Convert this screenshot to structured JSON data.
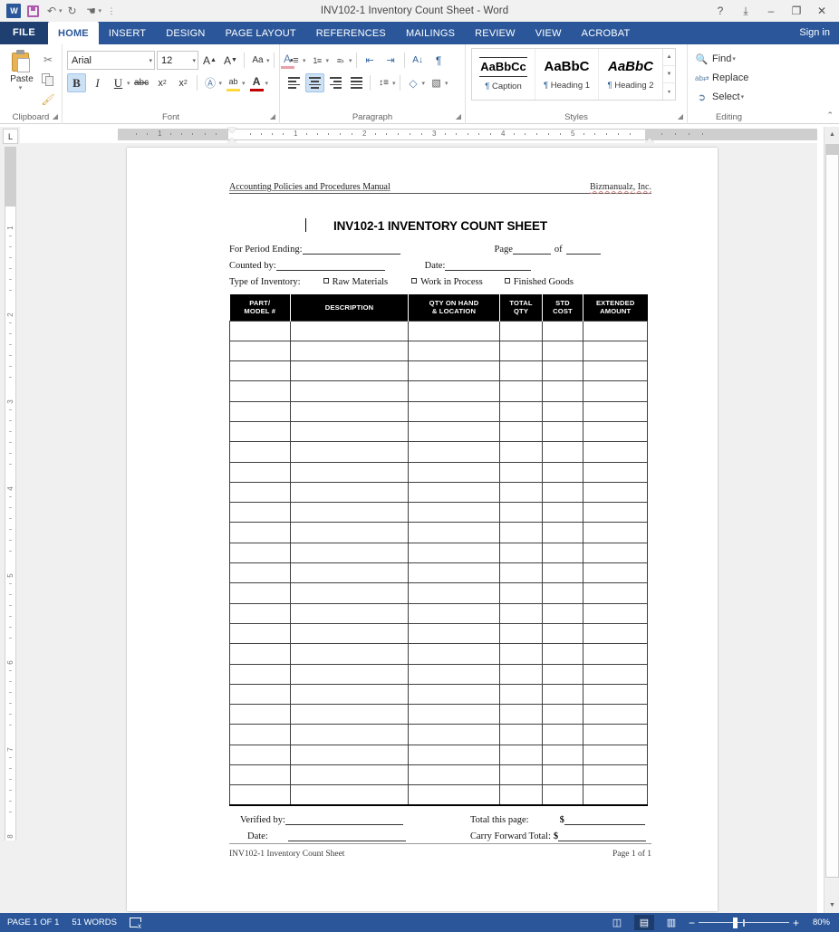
{
  "window": {
    "title": "INV102-1 Inventory Count Sheet - Word",
    "quick_access": [
      {
        "name": "word-logo",
        "glyph": "W"
      },
      {
        "name": "save-icon",
        "glyph": "save"
      },
      {
        "name": "undo-icon",
        "glyph": "↶"
      },
      {
        "name": "redo-icon",
        "glyph": "↻"
      },
      {
        "name": "touch-mouse-mode-icon",
        "glyph": "☚"
      },
      {
        "name": "customize-qat-icon",
        "glyph": "∴"
      }
    ],
    "controls": {
      "help": "?",
      "ribbon_display": "⤓",
      "minimize": "–",
      "maximize": "❐",
      "close": "✕"
    }
  },
  "ribbon": {
    "file_tab": "FILE",
    "tabs": [
      {
        "label": "HOME",
        "active": true
      },
      {
        "label": "INSERT",
        "active": false
      },
      {
        "label": "DESIGN",
        "active": false
      },
      {
        "label": "PAGE LAYOUT",
        "active": false
      },
      {
        "label": "REFERENCES",
        "active": false
      },
      {
        "label": "MAILINGS",
        "active": false
      },
      {
        "label": "REVIEW",
        "active": false
      },
      {
        "label": "VIEW",
        "active": false
      },
      {
        "label": "ACROBAT",
        "active": false
      }
    ],
    "sign_in": "Sign in",
    "groups": {
      "clipboard": {
        "label": "Clipboard",
        "paste": "Paste",
        "cut": "Cut",
        "copy": "Copy",
        "format_painter": "Format Painter"
      },
      "font": {
        "label": "Font",
        "font_name": "Arial",
        "font_size": "12",
        "grow_font": "A",
        "shrink_font": "A",
        "change_case": "Aa",
        "clear_formatting": "A",
        "bold": "B",
        "italic": "I",
        "underline": "U",
        "strikethrough": "abc",
        "subscript": "x",
        "superscript": "x",
        "text_effects": "A",
        "highlight": "ab",
        "font_color": "A"
      },
      "paragraph": {
        "label": "Paragraph",
        "bullets": "•≡",
        "numbering": "≡",
        "multilevel": "≡",
        "decrease_indent": "⇤",
        "increase_indent": "⇥",
        "sort": "A↓",
        "show_marks": "¶",
        "align_left": "left",
        "align_center": "center",
        "align_right": "right",
        "justify": "justify",
        "line_spacing": "↕≡",
        "shading": "shade",
        "borders": "borders"
      },
      "styles": {
        "label": "Styles",
        "items": [
          {
            "preview": "AaBbCc",
            "name": "Caption",
            "mark": "¶"
          },
          {
            "preview": "AaBbC",
            "name": "Heading 1",
            "mark": "¶"
          },
          {
            "preview": "AaBbC",
            "name": "Heading 2",
            "mark": "¶"
          }
        ]
      },
      "editing": {
        "label": "Editing",
        "find": "Find",
        "replace": "Replace",
        "select": "Select"
      }
    },
    "collapse": "⌃"
  },
  "rulers": {
    "tab_selector": "L",
    "horizontal_marks": [
      "1",
      "1",
      "2",
      "3",
      "4",
      "5"
    ],
    "vertical_marks": [
      "1",
      "2",
      "3",
      "4",
      "5",
      "6",
      "7",
      "8"
    ]
  },
  "document": {
    "header": {
      "left": "Accounting Policies and Procedures Manual",
      "right": "Bizmanualz, Inc."
    },
    "title": "INV102-1 INVENTORY COUNT SHEET",
    "fields": {
      "period_label": "For Period Ending:",
      "page_label": "Page",
      "page_of": "of",
      "counted_by_label": "Counted by:",
      "date_label": "Date:",
      "inventory_type_label": "Type of Inventory:",
      "inventory_types": [
        "Raw Materials",
        "Work in Process",
        "Finished Goods"
      ]
    },
    "table": {
      "columns": [
        {
          "line1": "PART/",
          "line2": "MODEL #"
        },
        {
          "line1": "DESCRIPTION",
          "line2": ""
        },
        {
          "line1": "QTY ON HAND",
          "line2": "& LOCATION"
        },
        {
          "line1": "TOTAL",
          "line2": "QTY"
        },
        {
          "line1": "STD",
          "line2": "COST"
        },
        {
          "line1": "EXTENDED",
          "line2": "AMOUNT"
        }
      ],
      "row_count": 24,
      "rows": []
    },
    "bottom": {
      "verified_by_label": "Verified by:",
      "date_label": "Date:",
      "total_this_page_label": "Total this page:",
      "total_this_page_currency": "$",
      "carry_forward_label": "Carry Forward Total:",
      "carry_forward_currency": "$"
    },
    "footer": {
      "left": "INV102-1 Inventory Count Sheet",
      "right": "Page 1 of 1"
    }
  },
  "status_bar": {
    "page_info": "PAGE 1 OF 1",
    "word_count": "51 WORDS",
    "proofing_icon": "proofing-errors-icon",
    "views": [
      {
        "name": "read-mode",
        "glyph": "◫",
        "selected": false
      },
      {
        "name": "print-layout",
        "glyph": "▤",
        "selected": true
      },
      {
        "name": "web-layout",
        "glyph": "▥",
        "selected": false
      }
    ],
    "zoom_out": "−",
    "zoom_in": "+",
    "zoom_level": "80%"
  },
  "colors": {
    "accent": "#2b579a",
    "file_tab": "#1e3f6f",
    "table_header": "#000000",
    "canvas": "#f0f0f0"
  }
}
